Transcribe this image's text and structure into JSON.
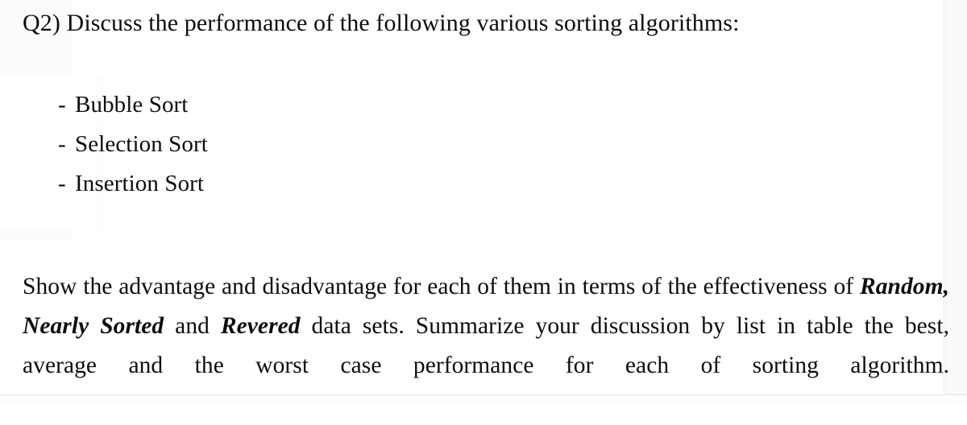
{
  "document": {
    "question_number": "Q2)",
    "question_line": "Q2) Discuss the performance of the following various sorting algorithms:",
    "list": {
      "bullet": "-",
      "items": [
        {
          "label": "Bubble Sort"
        },
        {
          "label": "Selection Sort"
        },
        {
          "label": "Insertion Sort"
        }
      ]
    },
    "paragraph": {
      "segment_1": "Show the advantage and disadvantage for each of them in terms of the effectiveness of ",
      "emphasis_1": "Random, Nearly Sorted",
      "segment_2": " and ",
      "emphasis_2": "Revered",
      "segment_3": " data sets. Summarize your discussion by list in table the best, average and the worst case performance for each of sorting algorithm."
    },
    "colors": {
      "text": "#0d0d0d",
      "page_background": "#ffffff",
      "rule": "#e6e6e6"
    }
  }
}
